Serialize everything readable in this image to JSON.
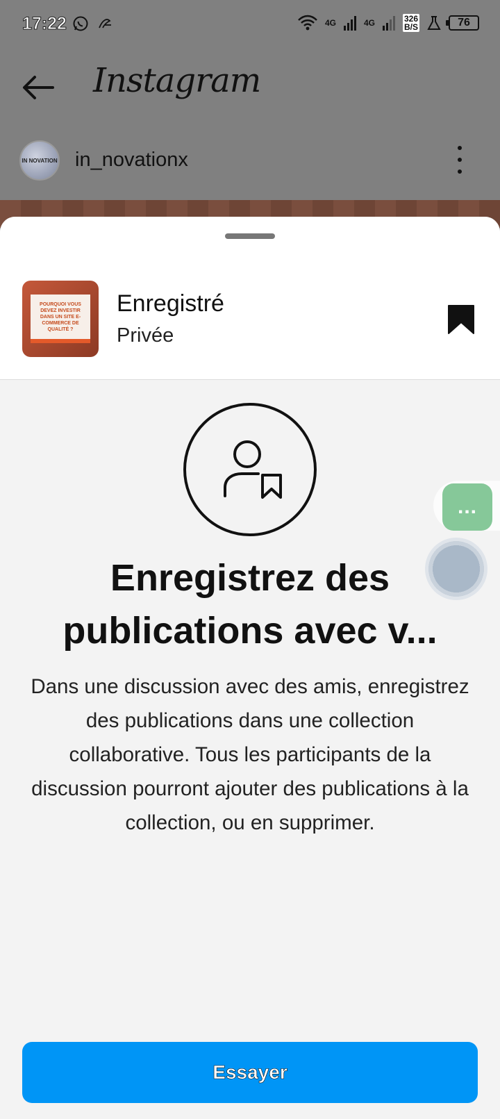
{
  "status_bar": {
    "time": "17:22",
    "network_1": "4G",
    "network_2": "4G",
    "speed_value": "326",
    "speed_unit": "B/S",
    "battery": "76",
    "icons": [
      "whatsapp-icon",
      "app-icon",
      "wifi-icon",
      "signal-icon",
      "signal-icon",
      "lab-icon",
      "battery-icon"
    ]
  },
  "header": {
    "back_icon": "back-arrow-icon",
    "logo": "Instagram"
  },
  "post": {
    "avatar_text": "IN NOVATION",
    "username": "in_novationx",
    "more_icon": "more-vertical-icon"
  },
  "sheet": {
    "collection": {
      "thumb_text": "POURQUOI VOUS DEVEZ INVESTIR DANS UN SITE E-COMMERCE DE QUALITÉ ?",
      "title": "Enregistré",
      "privacy": "Privée",
      "bookmark_icon": "bookmark-filled-icon"
    },
    "hero_icon": "person-bookmark-icon",
    "heading": "Enregistrez des publications avec v...",
    "description": "Dans une discussion avec des amis, enregistrez des publications dans une collection collaborative. Tous les participants de la discussion pourront ajouter des publications à la collection, ou en supprimer.",
    "button_label": "Essayer"
  },
  "floating": {
    "chat_label": "...",
    "accent": "#86c899"
  },
  "colors": {
    "primary_button": "#0095f6",
    "overlay": "#808080",
    "sheet_bg": "#f3f3f3"
  }
}
